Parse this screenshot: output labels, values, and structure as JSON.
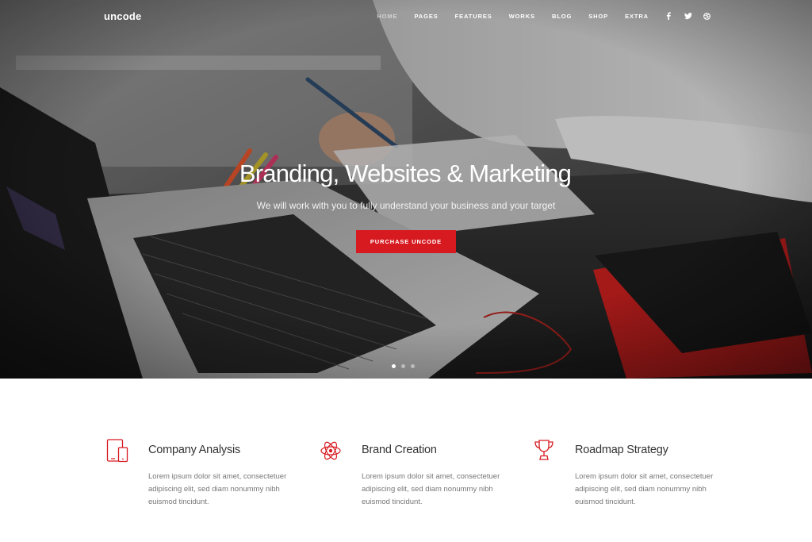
{
  "nav": {
    "logo": "uncode",
    "items": [
      {
        "label": "HOME",
        "active": true
      },
      {
        "label": "PAGES"
      },
      {
        "label": "FEATURES"
      },
      {
        "label": "WORKS"
      },
      {
        "label": "BLOG"
      },
      {
        "label": "SHOP"
      },
      {
        "label": "EXTRA"
      }
    ],
    "social": [
      {
        "icon": "facebook-icon",
        "glyph": "f"
      },
      {
        "icon": "twitter-icon",
        "glyph": "t"
      },
      {
        "icon": "dribbble-icon",
        "glyph": "d"
      }
    ]
  },
  "hero": {
    "title": "Branding, Websites & Marketing",
    "subtitle": "We will work with you to fully understand your business and your target",
    "cta_label": "PURCHASE UNCODE",
    "slides": 3,
    "active_slide": 1
  },
  "features": [
    {
      "icon": "tablet-phone-icon",
      "title": "Company Analysis",
      "text": "Lorem ipsum dolor sit amet, consectetuer adipiscing elit, sed diam nonummy nibh euismod tincidunt."
    },
    {
      "icon": "atom-icon",
      "title": "Brand Creation",
      "text": "Lorem ipsum dolor sit amet, consectetuer adipiscing elit, sed diam nonummy nibh euismod tincidunt."
    },
    {
      "icon": "trophy-icon",
      "title": "Roadmap Strategy",
      "text": "Lorem ipsum dolor sit amet, consectetuer adipiscing elit, sed diam nonummy nibh euismod tincidunt."
    }
  ],
  "colors": {
    "accent": "#d71920",
    "heading": "#333333",
    "body_text": "#777777"
  }
}
